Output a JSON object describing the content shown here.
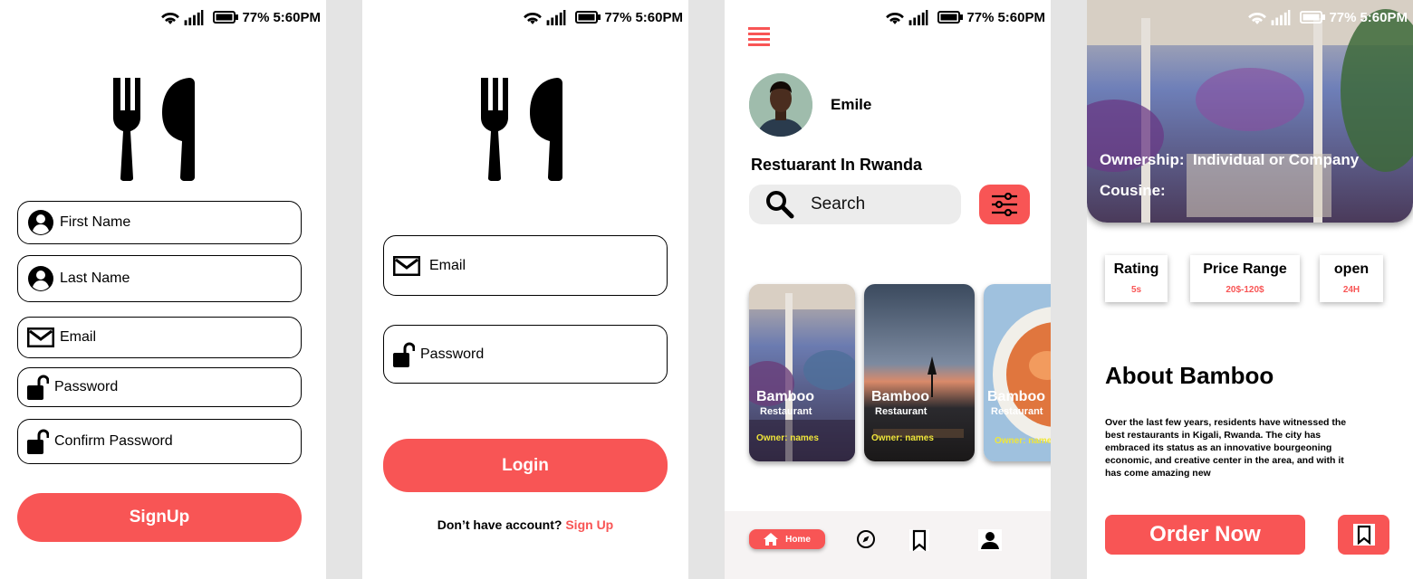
{
  "status_bar": {
    "battery": "77%",
    "time": "5:60PM"
  },
  "colors": {
    "accent": "#f85555",
    "owner_text": "#f0e63a"
  },
  "signup_screen": {
    "icon": "fork-knife-icon",
    "fields": [
      {
        "label": "First Name",
        "icon": "user-icon"
      },
      {
        "label": "Last Name",
        "icon": "user-icon"
      },
      {
        "label": "Email",
        "icon": "mail-icon"
      },
      {
        "label": "Password",
        "icon": "lock-icon"
      },
      {
        "label": "Confirm Password",
        "icon": "lock-icon"
      }
    ],
    "submit_label": "SignUp"
  },
  "login_screen": {
    "icon": "fork-knife-icon",
    "fields": [
      {
        "label": "Email",
        "icon": "mail-icon"
      },
      {
        "label": "Password",
        "icon": "lock-icon"
      }
    ],
    "submit_label": "Login",
    "no_account_text": "Don’t have account?",
    "signup_link": "Sign Up"
  },
  "home_screen": {
    "user_name": "Emile",
    "title": "Restuarant In Rwanda",
    "search_placeholder": "Search",
    "cards": [
      {
        "name": "Bamboo",
        "subtitle": "Restaurant",
        "owner": "Owner: names"
      },
      {
        "name": "Bamboo",
        "subtitle": "Restaurant",
        "owner": "Owner: names"
      },
      {
        "name": "Bamboo",
        "subtitle": "Restaurant",
        "owner": "Owner: names"
      }
    ],
    "nav": {
      "home_label": "Home",
      "icons": [
        "compass-icon",
        "bookmark-icon",
        "person-icon"
      ]
    }
  },
  "detail_screen": {
    "ownership_label": "Ownership:",
    "ownership_value": "Individual or Company",
    "cuisine_label": "Cousine:",
    "info": [
      {
        "title": "Rating",
        "value": "5s"
      },
      {
        "title": "Price Range",
        "value": "20$-120$"
      },
      {
        "title": "open",
        "value": "24H"
      }
    ],
    "about_title": "About Bamboo",
    "about_text": "Over the last few years, residents have witnessed the best restaurants in Kigali, Rwanda. The city has embraced its status as an innovative bourgeoning economic, and creative center in the area, and with it has come amazing new",
    "order_label": "Order Now"
  }
}
